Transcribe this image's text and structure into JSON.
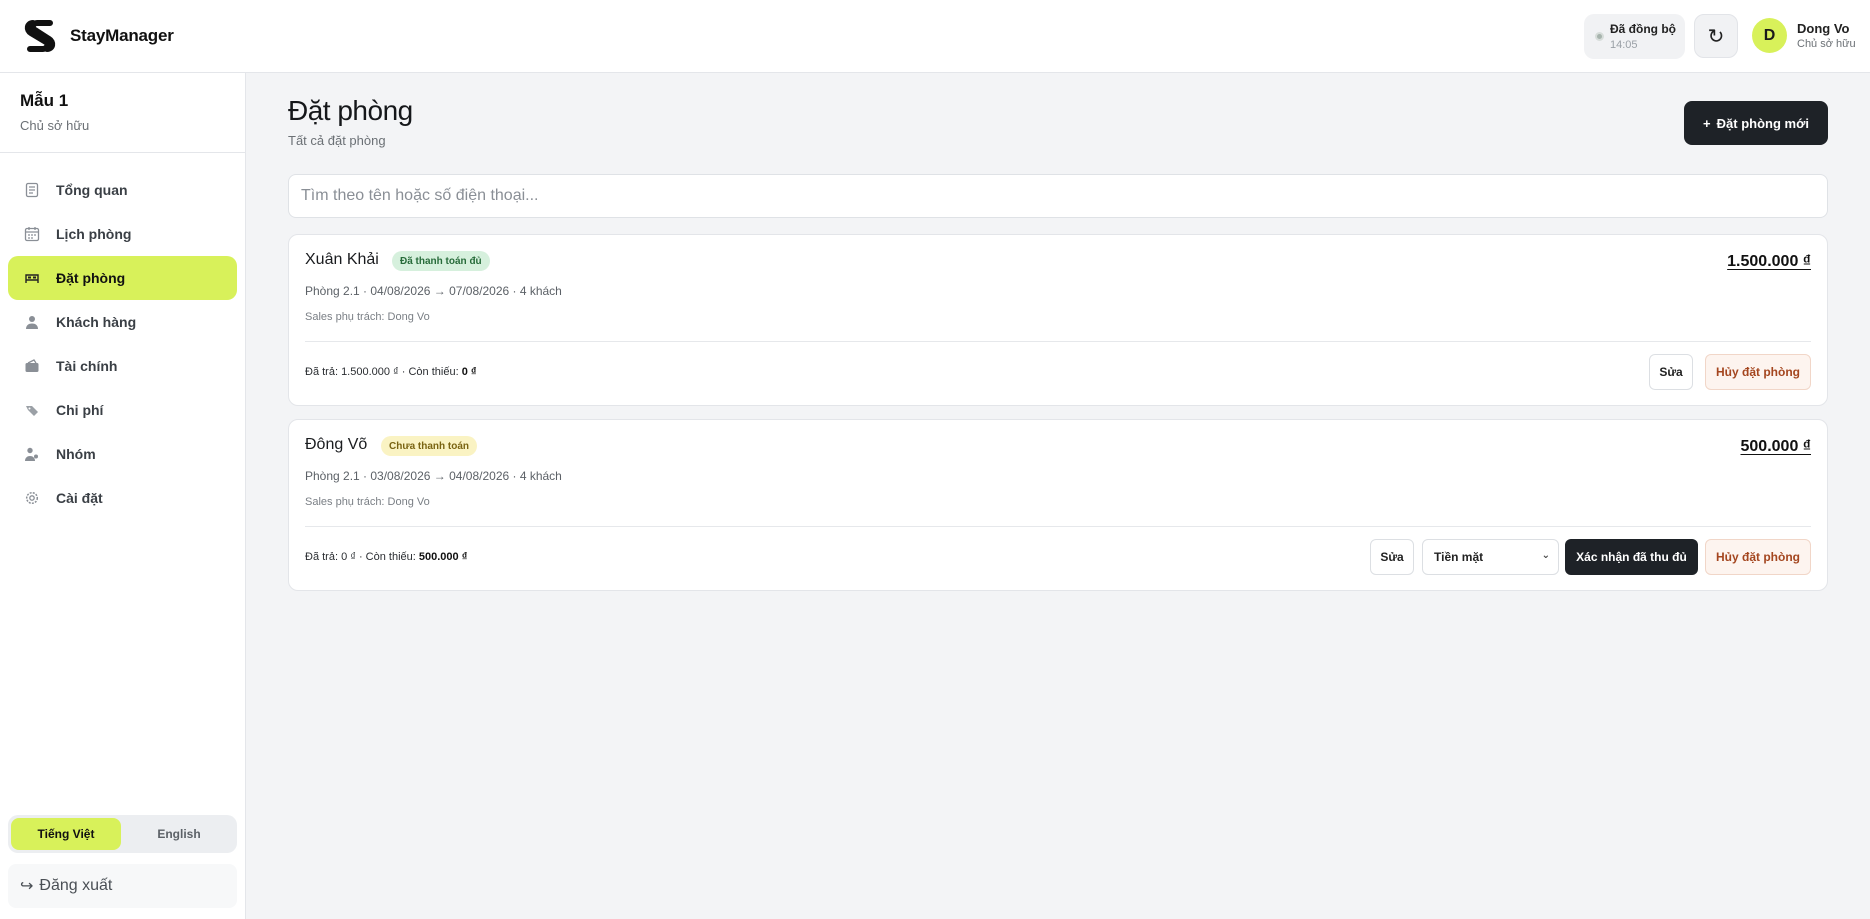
{
  "app": {
    "name": "StayManager"
  },
  "header": {
    "sync_label": "Đã đồng bộ",
    "sync_time": "14:05",
    "refresh_icon": "↻",
    "user": {
      "initial": "D",
      "name": "Dong Vo",
      "role": "Chủ sở hữu"
    }
  },
  "sidebar": {
    "workspace": {
      "name": "Mẫu 1",
      "role": "Chủ sở hữu"
    },
    "items": [
      {
        "label": "Tổng quan",
        "icon": "document-icon",
        "active": false
      },
      {
        "label": "Lịch phòng",
        "icon": "calendar-icon",
        "active": false
      },
      {
        "label": "Đặt phòng",
        "icon": "bed-icon",
        "active": true
      },
      {
        "label": "Khách hàng",
        "icon": "user-icon",
        "active": false
      },
      {
        "label": "Tài chính",
        "icon": "wallet-icon",
        "active": false
      },
      {
        "label": "Chi phí",
        "icon": "tag-icon",
        "active": false
      },
      {
        "label": "Nhóm",
        "icon": "team-icon",
        "active": false
      },
      {
        "label": "Cài đặt",
        "icon": "gear-icon",
        "active": false
      }
    ],
    "languages": [
      {
        "label": "Tiếng Việt",
        "active": true
      },
      {
        "label": "English",
        "active": false
      }
    ],
    "logout_icon": "↪",
    "logout_label": "Đăng xuất"
  },
  "page": {
    "title": "Đặt phòng",
    "subtitle": "Tất cả đặt phòng",
    "new_button": "Đặt phòng mới",
    "new_button_icon": "+",
    "search_placeholder": "Tìm theo tên hoặc số điện thoại..."
  },
  "bookings": [
    {
      "guest": "Xuân Khải",
      "status": "Đã thanh toán đủ",
      "status_type": "paid",
      "amount": "1.500.000 ₫",
      "meta": "Phòng 2.1 · 04/08/2026 → 07/08/2026 · 4 khách",
      "sales": "Sales phụ trách: Dong Vo",
      "paid_label": "Đã trả: 1.500.000 ₫ · Còn thiếu: ",
      "remaining": "0 ₫",
      "edit": "Sửa",
      "cancel": "Hủy đặt phòng"
    },
    {
      "guest": "Đông Võ",
      "status": "Chưa thanh toán",
      "status_type": "unpaid",
      "amount": "500.000 ₫",
      "meta": "Phòng 2.1 · 03/08/2026 → 04/08/2026 · 4 khách",
      "sales": "Sales phụ trách: Dong Vo",
      "paid_label": "Đã trả: 0 ₫ · Còn thiếu: ",
      "remaining": "500.000 ₫",
      "edit": "Sửa",
      "method": "Tiền mặt",
      "confirm": "Xác nhận đã thu đủ",
      "cancel": "Hủy đặt phòng"
    }
  ],
  "colors": {
    "accent": "#d8f15a",
    "dark": "#1e2227",
    "danger": "#a4461f"
  }
}
